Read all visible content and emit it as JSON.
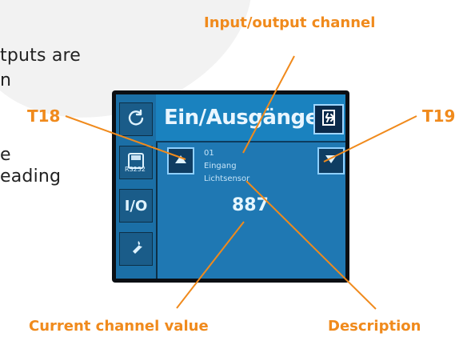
{
  "background_text": {
    "line1": "tputs are",
    "line2": "n",
    "line3": "e",
    "line4": "eading"
  },
  "callouts": {
    "top": "Input/output channel",
    "left": "T18",
    "right": "T19",
    "bottom_left": "Current channel value",
    "bottom_right": "Description"
  },
  "screen": {
    "title": "Ein/Ausgänge",
    "sidebar": {
      "items": [
        {
          "label": "",
          "icon": "refresh-icon"
        },
        {
          "label": "RS232",
          "icon": "save-icon"
        },
        {
          "label": "I/O",
          "icon": "io-icon"
        },
        {
          "label": "",
          "icon": "wrench-icon"
        }
      ]
    },
    "channel": {
      "number": "01",
      "type": "Eingang",
      "description": "Lichtsensor",
      "value": "887"
    }
  },
  "colors": {
    "callout": "#f08a1c",
    "screen_blue": "#1f78b3",
    "device_black": "#0b0f14"
  }
}
